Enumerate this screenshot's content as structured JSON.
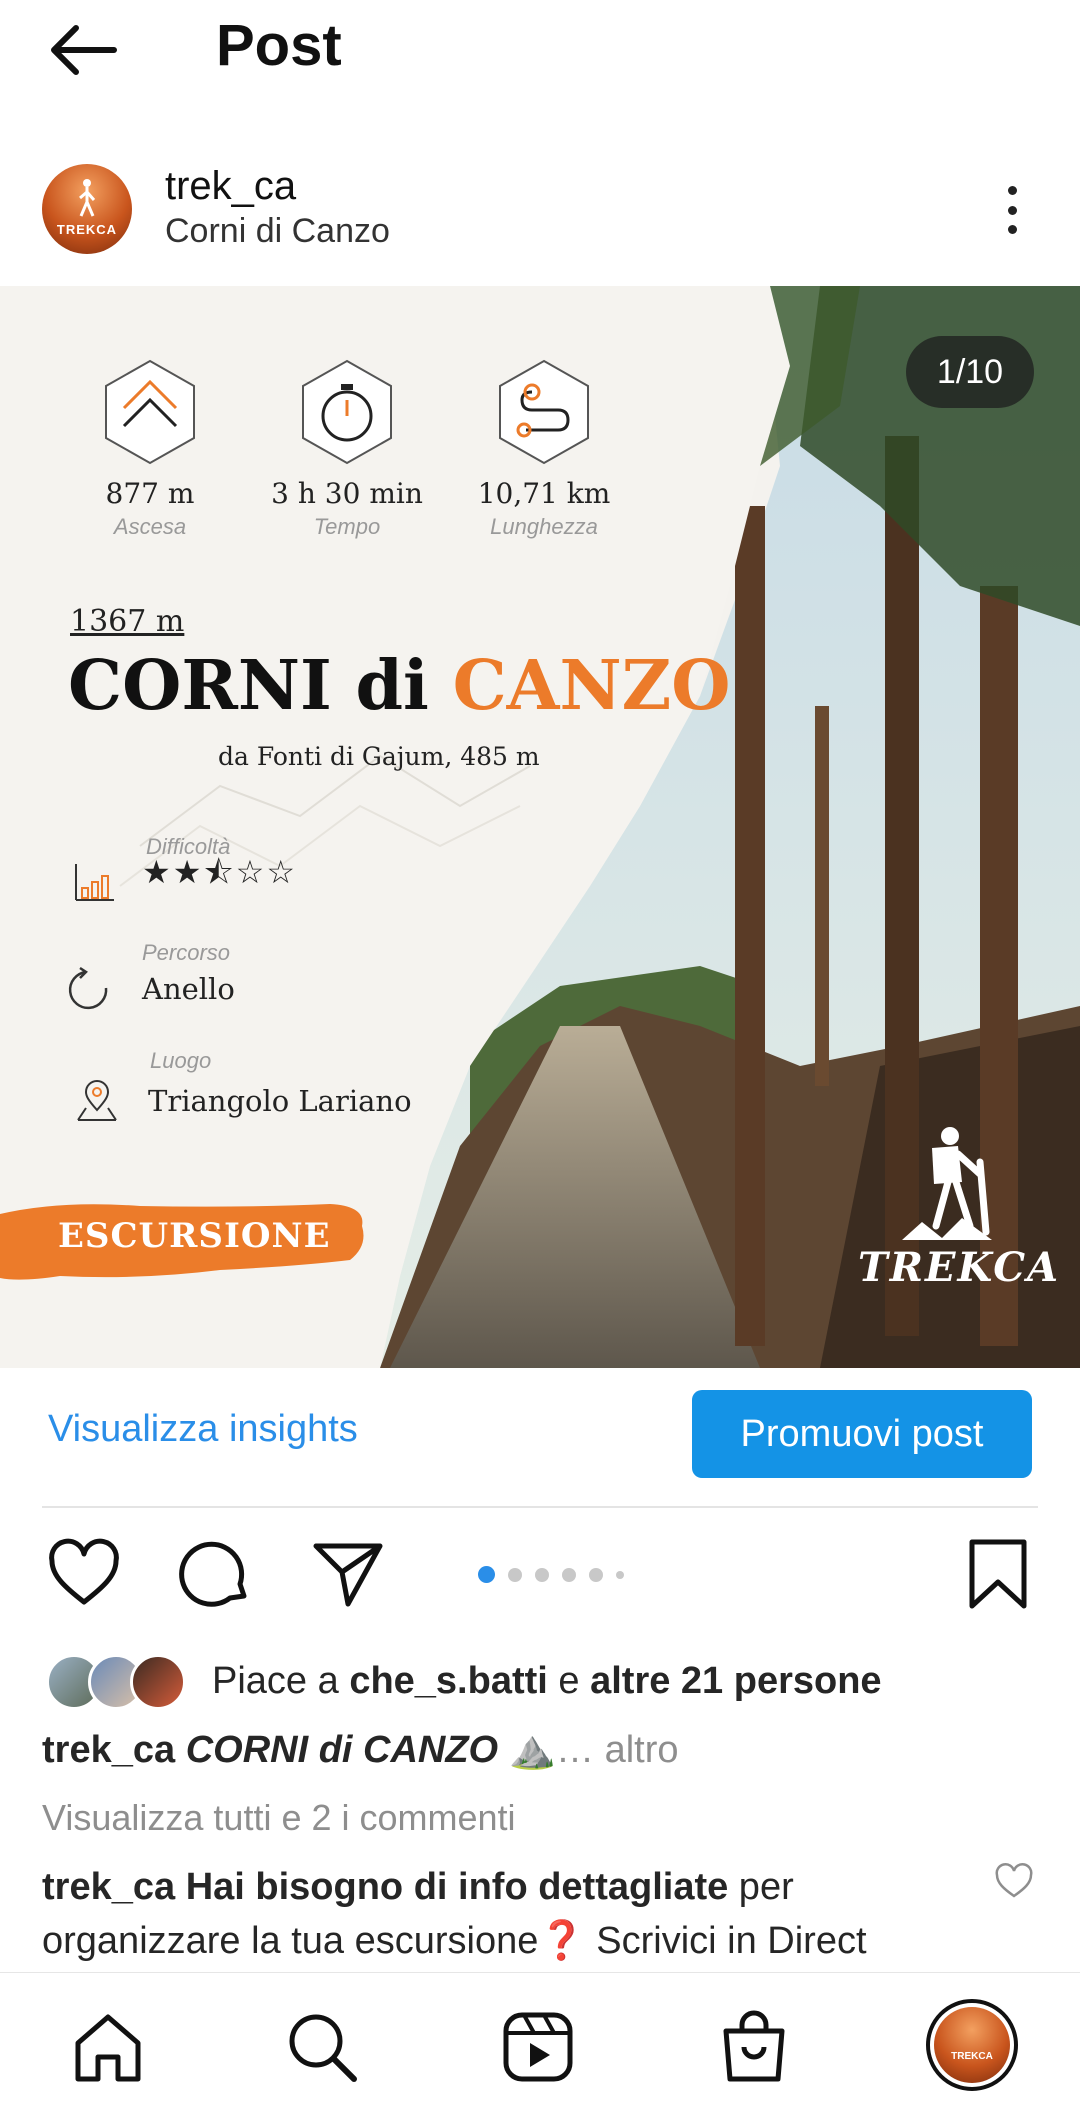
{
  "header": {
    "title": "Post",
    "back_icon": "arrow-left-icon"
  },
  "author": {
    "username": "trek_ca",
    "location": "Corni di Canzo",
    "avatar_text": "TREKCA"
  },
  "post": {
    "counter": "1/10",
    "stats": [
      {
        "value": "877 m",
        "label": "Ascesa",
        "icon": "chevron-up-icon"
      },
      {
        "value": "3 h 30 min",
        "label": "Tempo",
        "icon": "stopwatch-icon"
      },
      {
        "value": "10,71 km",
        "label": "Lunghezza",
        "icon": "route-icon"
      }
    ],
    "altitude": "1367 m",
    "title_main": "CORNI di ",
    "title_accent": "CANZO",
    "start_point": "da Fonti di Gajum, 485 m",
    "difficulty_label": "Difficoltà",
    "difficulty_rating": 2.5,
    "difficulty_stars": "★★⯪☆☆",
    "route_label": "Percorso",
    "route_value": "Anello",
    "place_label": "Luogo",
    "place_value": "Triangolo Lariano",
    "tag": "ESCURSIONE",
    "brand": "TREKCA",
    "accent_color": "#ec7b2a"
  },
  "actions": {
    "insights": "Visualizza insights",
    "promote": "Promuovi post",
    "carousel_count": 6,
    "carousel_active": 1
  },
  "likes": {
    "prefix": "Piace a ",
    "user": "che_s.batti",
    "mid": " e ",
    "others": "altre 21 persone"
  },
  "caption": {
    "user": "trek_ca",
    "text": "CORNI di CANZO",
    "emoji": "⛰️",
    "more": "… altro"
  },
  "comments_link": "Visualizza tutti e 2 i commenti",
  "comment": {
    "user": "trek_ca",
    "bold_text": "Hai bisogno di info dettagliate",
    "text": " per organizzare la tua escursione❓ Scrivici in Direct"
  },
  "colors": {
    "primary_blue": "#1493e6",
    "link_blue": "#2a8ee8",
    "orange": "#ec7b2a"
  }
}
